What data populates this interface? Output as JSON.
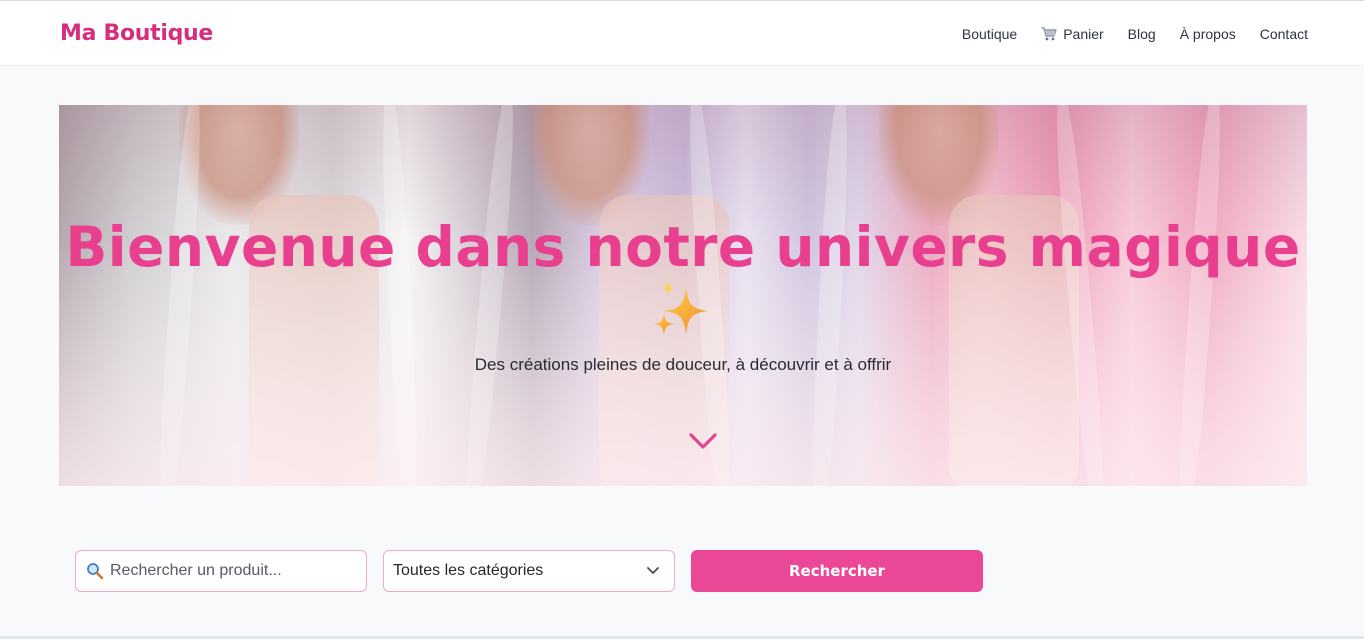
{
  "header": {
    "brand": "Ma Boutique",
    "nav": [
      {
        "label": "Boutique",
        "icon": null
      },
      {
        "label": "Panier",
        "icon": "cart-icon"
      },
      {
        "label": "Blog",
        "icon": null
      },
      {
        "label": "À propos",
        "icon": null
      },
      {
        "label": "Contact",
        "icon": null
      }
    ]
  },
  "hero": {
    "title": "Bienvenue dans notre univers magique",
    "title_emoji": "sparkles-icon",
    "subtitle": "Des créations pleines de douceur, à découvrir et à offrir",
    "scroll_icon": "chevron-down-icon"
  },
  "search": {
    "placeholder": "Rechercher un produit...",
    "icon": "magnifier-icon",
    "category_selected": "Toutes les catégories",
    "button_label": "Rechercher"
  },
  "colors": {
    "brand": "#d62d7c",
    "accent": "#ea4897",
    "hero_title": "#e83f8f",
    "input_border": "#f0a9c8",
    "background": "#f8f9fb"
  }
}
